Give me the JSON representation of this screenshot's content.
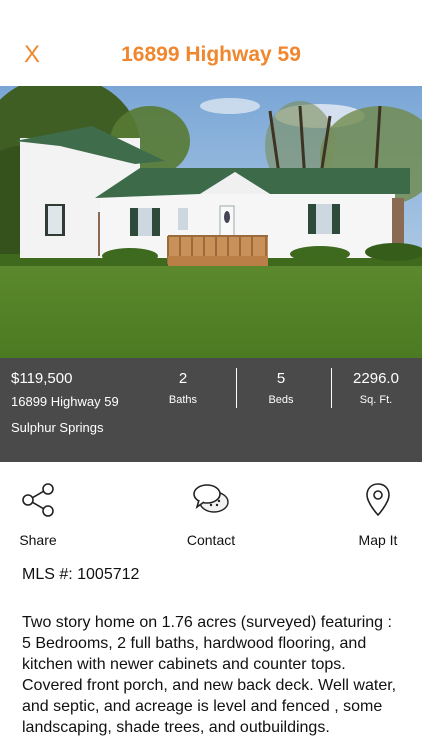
{
  "header": {
    "close_label": "X",
    "title": "16899 Highway 59",
    "accent": "#f0872e"
  },
  "photo": {
    "icon": "house-photo"
  },
  "listing": {
    "price": "$119,500",
    "address": "16899 Highway 59",
    "city": "Sulphur Springs",
    "baths_value": "2",
    "baths_label": "Baths",
    "beds_value": "5",
    "beds_label": "Beds",
    "sqft_value": "2296.0",
    "sqft_label": "Sq. Ft."
  },
  "actions": {
    "share_label": "Share",
    "contact_label": "Contact",
    "map_label": "Map It"
  },
  "details": {
    "mls": "MLS #: 1005712",
    "description": "Two story home on 1.76 acres (surveyed) featuring : 5 Bedrooms, 2 full baths, hardwood flooring, and kitchen with newer cabinets and counter tops. Covered front porch, and new back deck. Well water, and septic, and acreage is level and fenced , some landscaping, shade trees, and outbuildings."
  }
}
